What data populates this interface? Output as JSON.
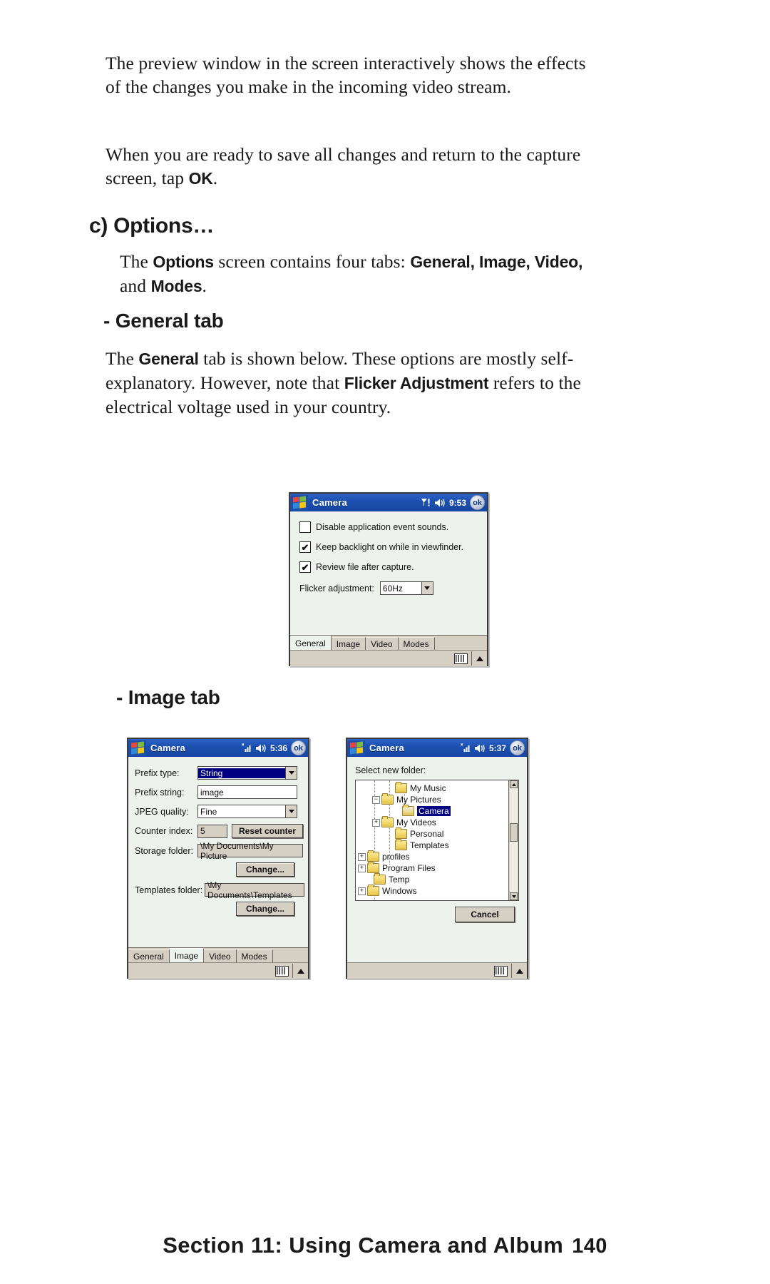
{
  "page": {
    "paragraph1": "The preview window in the screen interactively shows the effects of the changes you make in the incoming video stream.",
    "paragraph2_a": "When you are ready to save all changes and return to the capture screen, tap ",
    "paragraph2_b": "OK",
    "paragraph2_c": ".",
    "heading_c": "c) Options…",
    "options_par_1": "The ",
    "options_par_b1": "Options",
    "options_par_2": " screen contains four tabs: ",
    "options_par_b2": "General, Image, Video,",
    "options_par_3": "and ",
    "options_par_b3": "Modes",
    "options_par_4": ".",
    "heading_general_tab": "- General tab",
    "general_par_1": "The ",
    "general_par_b1": "General",
    "general_par_2": " tab is shown below. These options are mostly self-explanatory.  However, note that ",
    "general_par_b2": "Flicker Adjustment",
    "general_par_3": " refers to the electrical voltage used in your country.",
    "heading_image_tab": "- Image tab",
    "footer_title": "Section 11: Using Camera and Album",
    "footer_page": "140"
  },
  "screenshot_general": {
    "title": "Camera",
    "clock": "9:53",
    "ok_label": "ok",
    "checkboxes": [
      {
        "label": "Disable application event sounds.",
        "checked": false
      },
      {
        "label": "Keep backlight on while in viewfinder.",
        "checked": true
      },
      {
        "label": "Review file after capture.",
        "checked": true
      }
    ],
    "flicker_label": "Flicker adjustment:",
    "flicker_value": "60Hz",
    "tabs": [
      "General",
      "Image",
      "Video",
      "Modes"
    ],
    "active_tab": "General"
  },
  "screenshot_image": {
    "title": "Camera",
    "clock": "5:36",
    "ok_label": "ok",
    "fields": [
      {
        "label": "Prefix type:",
        "value": "String",
        "kind": "combo-selected"
      },
      {
        "label": "Prefix string:",
        "value": "image",
        "kind": "text"
      },
      {
        "label": "JPEG quality:",
        "value": "Fine",
        "kind": "combo"
      },
      {
        "label": "Counter index:",
        "value": "5",
        "kind": "counter"
      },
      {
        "label": "Storage folder:",
        "value": "\\My Documents\\My Picture",
        "kind": "path"
      },
      {
        "label": "Templates folder:",
        "value": "\\My Documents\\Templates",
        "kind": "path"
      }
    ],
    "reset_counter_label": "Reset counter",
    "change_label_1": "Change...",
    "change_label_2": "Change...",
    "tabs": [
      "General",
      "Image",
      "Video",
      "Modes"
    ],
    "active_tab": "Image"
  },
  "screenshot_folder": {
    "title": "Camera",
    "clock": "5:37",
    "ok_label": "ok",
    "prompt": "Select new folder:",
    "tree": [
      {
        "label": "My Music",
        "depth": 2,
        "expander": "none",
        "selected": false,
        "open": false
      },
      {
        "label": "My Pictures",
        "depth": 1,
        "expander": "minus",
        "selected": false,
        "open": false
      },
      {
        "label": "Camera",
        "depth": 2,
        "expander": "none",
        "selected": true,
        "open": true
      },
      {
        "label": "My Videos",
        "depth": 1,
        "expander": "plus",
        "selected": false,
        "open": false
      },
      {
        "label": "Personal",
        "depth": 2,
        "expander": "none",
        "selected": false,
        "open": false
      },
      {
        "label": "Templates",
        "depth": 2,
        "expander": "none",
        "selected": false,
        "open": false
      },
      {
        "label": "profiles",
        "depth": 0,
        "expander": "plus",
        "selected": false,
        "open": false
      },
      {
        "label": "Program Files",
        "depth": 0,
        "expander": "plus",
        "selected": false,
        "open": false
      },
      {
        "label": "Temp",
        "depth": 1,
        "expander": "none",
        "selected": false,
        "open": false
      },
      {
        "label": "Windows",
        "depth": 0,
        "expander": "plus",
        "selected": false,
        "open": false
      }
    ],
    "cancel_label": "Cancel"
  },
  "colors": {
    "titlebar": "#1b4fae",
    "selection": "#000080",
    "chrome": "#d6cfc4",
    "screen": "#eef2ec"
  }
}
